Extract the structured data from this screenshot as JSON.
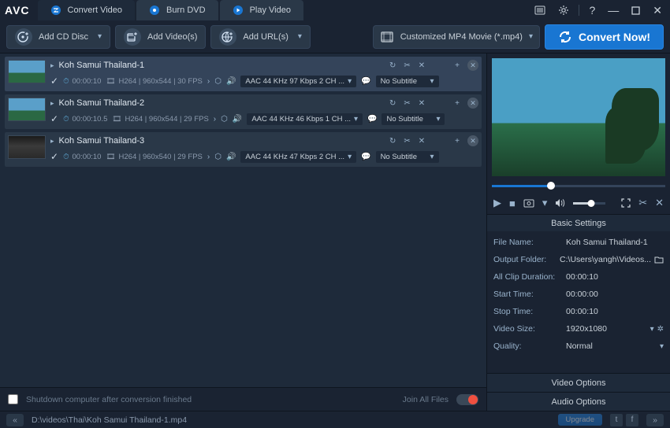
{
  "app": {
    "logo": "AVC"
  },
  "tabs": [
    {
      "label": "Convert Video",
      "icon": "convert-icon"
    },
    {
      "label": "Burn DVD",
      "icon": "dvd-icon"
    },
    {
      "label": "Play Video",
      "icon": "play-icon"
    }
  ],
  "toolbar": {
    "add_cd": "Add CD Disc",
    "add_videos": "Add Video(s)",
    "add_urls": "Add URL(s)",
    "profile": "Customized MP4 Movie (*.mp4)",
    "convert": "Convert Now!"
  },
  "files": [
    {
      "title": "Koh Samui Thailand-1",
      "duration": "00:00:10",
      "codec": "H264",
      "res": "960x544",
      "fps": "30 FPS",
      "audio": "AAC 44 KHz 97 Kbps 2 CH ...",
      "subtitle": "No Subtitle",
      "selected": true,
      "thumb": "beach"
    },
    {
      "title": "Koh Samui Thailand-2",
      "duration": "00:00:10.5",
      "codec": "H264",
      "res": "960x544",
      "fps": "29 FPS",
      "audio": "AAC 44 KHz 46 Kbps 1 CH ...",
      "subtitle": "No Subtitle",
      "selected": false,
      "thumb": "beach"
    },
    {
      "title": "Koh Samui Thailand-3",
      "duration": "00:00:10",
      "codec": "H264",
      "res": "960x540",
      "fps": "29 FPS",
      "audio": "AAC 44 KHz 47 Kbps 2 CH ...",
      "subtitle": "No Subtitle",
      "selected": false,
      "thumb": "indoor"
    }
  ],
  "left_footer": {
    "shutdown": "Shutdown computer after conversion finished",
    "join": "Join All Files"
  },
  "settings": {
    "header": "Basic Settings",
    "rows": {
      "file_name_label": "File Name:",
      "file_name": "Koh Samui Thailand-1",
      "output_folder_label": "Output Folder:",
      "output_folder": "C:\\Users\\yangh\\Videos...",
      "all_clip_label": "All Clip Duration:",
      "all_clip": "00:00:10",
      "start_label": "Start Time:",
      "start": "00:00:00",
      "stop_label": "Stop Time:",
      "stop": "00:00:10",
      "video_size_label": "Video Size:",
      "video_size": "1920x1080",
      "quality_label": "Quality:",
      "quality": "Normal"
    },
    "video_options": "Video Options",
    "audio_options": "Audio Options"
  },
  "statusbar": {
    "path": "D:\\videos\\Thai\\Koh Samui Thailand-1.mp4",
    "upgrade": "Upgrade"
  }
}
